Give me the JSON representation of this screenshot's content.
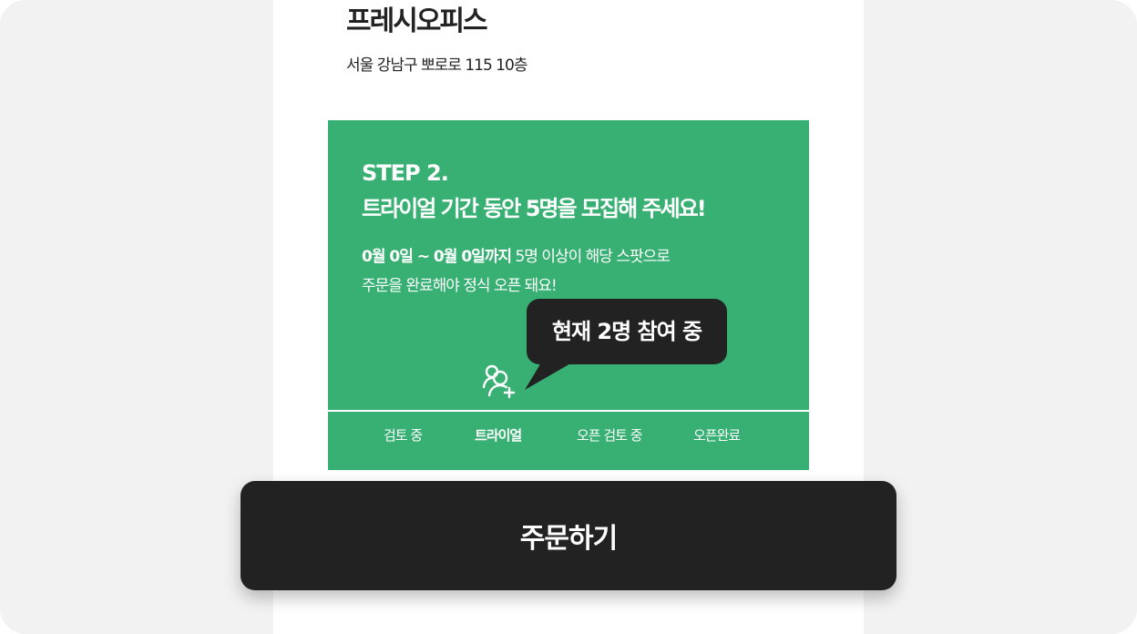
{
  "store": {
    "name": "프레시오피스",
    "address": "서울 강남구 뽀로로 115 10층"
  },
  "trial_card": {
    "step_label": "STEP 2.",
    "headline": "트라이얼 기간 동안 5명을 모집해 주세요!",
    "period": "0월 0일 ~ 0월 0일까지",
    "description_line1": " 5명 이상이 해당 스팟으로",
    "description_line2": "주문을 완료해야 정식 오픈 돼요!",
    "participants_tooltip": "현재 2명 참여 중",
    "participant_icon": "add-user-icon",
    "background_color": "#38b073"
  },
  "progress": {
    "steps": [
      {
        "label": "검토 중",
        "active": false
      },
      {
        "label": "트라이얼",
        "active": true
      },
      {
        "label": "오픈 검토 중",
        "active": false
      },
      {
        "label": "오픈완료",
        "active": false
      }
    ]
  },
  "cta": {
    "order_label": "주문하기",
    "background_color": "#222222"
  }
}
